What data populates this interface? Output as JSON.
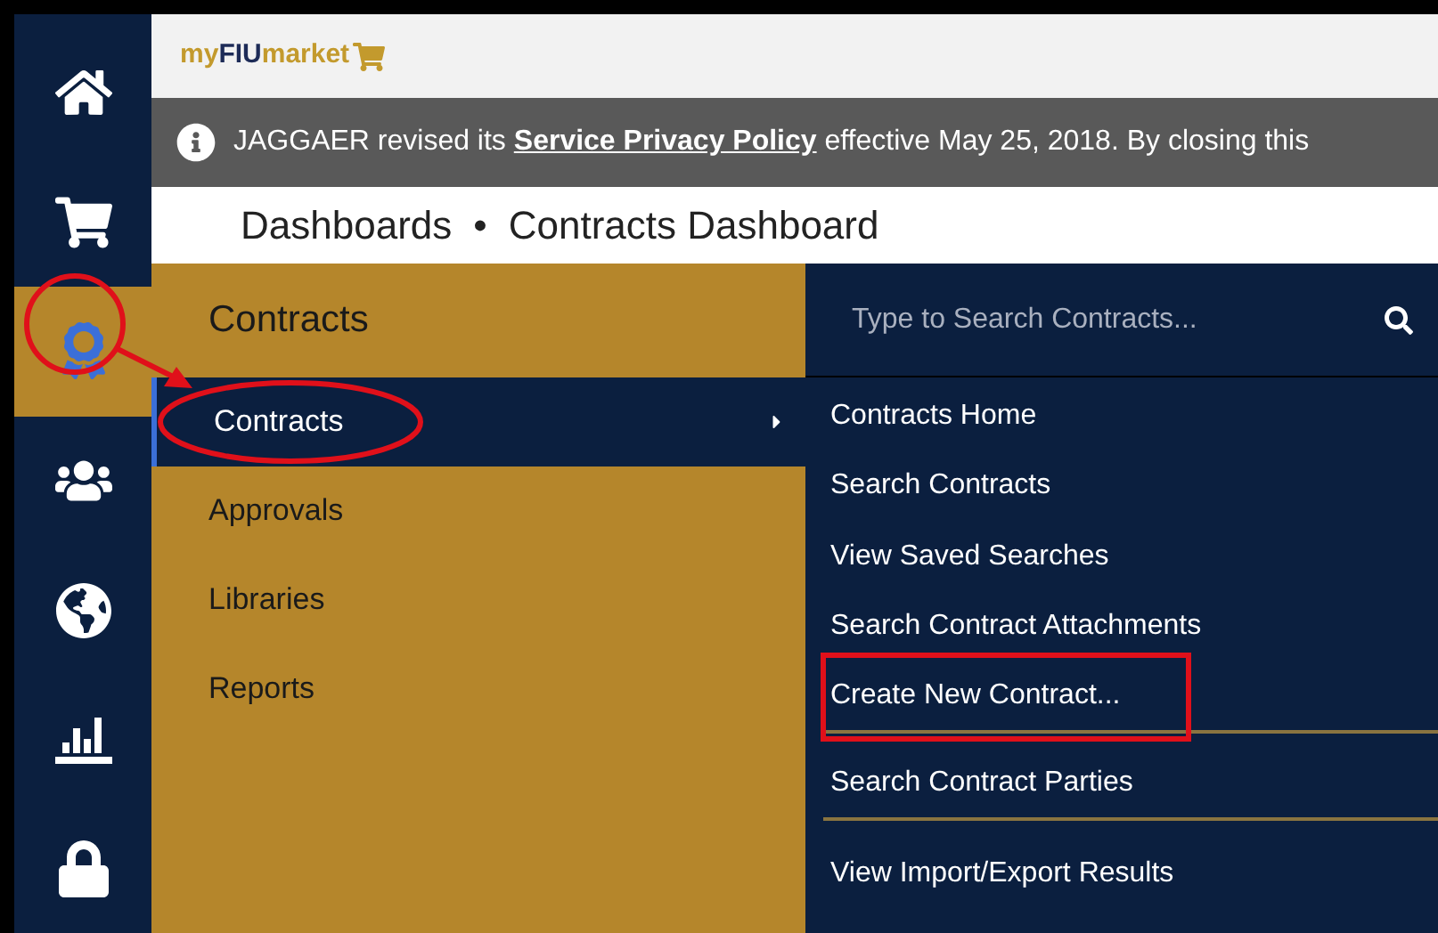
{
  "sidebar": {
    "items": [
      {
        "selected": false
      },
      {
        "selected": false
      },
      {
        "selected": true
      },
      {
        "selected": false
      },
      {
        "selected": false
      },
      {
        "selected": false
      },
      {
        "selected": false
      }
    ]
  },
  "header": {
    "logo": {
      "prefix": "my",
      "brand": "FIU",
      "suffix": "market"
    }
  },
  "notice": {
    "before": "JAGGAER revised its",
    "link": "Service Privacy Policy",
    "after": "effective May 25, 2018. By closing this"
  },
  "breadcrumb": [
    "Dashboards",
    "•",
    "Contracts Dashboard"
  ],
  "menu": {
    "title": "Contracts",
    "items": [
      {
        "label": "Contracts",
        "selected": true,
        "submenu": true
      },
      {
        "label": "Approvals",
        "selected": false,
        "submenu": false
      },
      {
        "label": "Libraries",
        "selected": false,
        "submenu": false
      },
      {
        "label": "Reports",
        "selected": false,
        "submenu": false
      }
    ]
  },
  "submenu": {
    "search": {
      "placeholder": "Type to Search Contracts..."
    },
    "items": [
      {
        "label": "Contracts Home",
        "divider_after": false
      },
      {
        "label": "Search Contracts",
        "divider_after": false
      },
      {
        "label": "View Saved Searches",
        "divider_after": false
      },
      {
        "label": "Search Contract Attachments",
        "divider_after": false
      },
      {
        "label": "Create New Contract...",
        "divider_after": true
      },
      {
        "label": "Search Contract Parties",
        "divider_after": true
      },
      {
        "label": "View Import/Export Results",
        "divider_after": false
      }
    ]
  }
}
